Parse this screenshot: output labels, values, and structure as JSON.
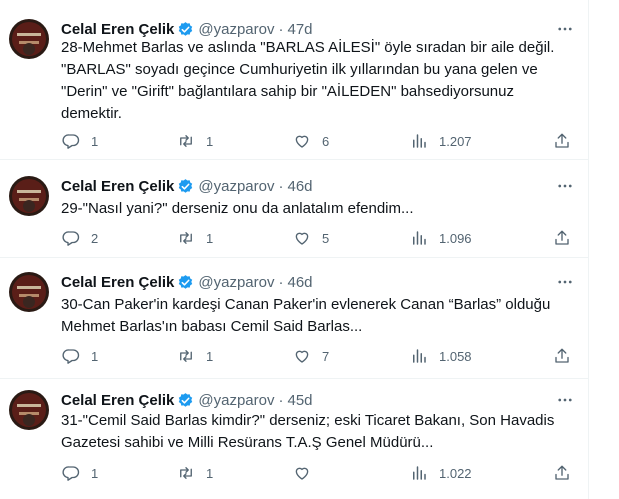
{
  "colors": {
    "text": "#0f1419",
    "secondary": "#536471",
    "verified": "#1d9bf0",
    "divider": "#eff3f4"
  },
  "tweets": [
    {
      "author": "Celal Eren Çelik",
      "handle": "@yazparov",
      "separator": "·",
      "time": "47d",
      "text": "28-Mehmet Barlas ve aslında \"BARLAS AİLESİ\" öyle sıradan bir aile değil.\n\"BARLAS\" soyadı geçince Cumhuriyetin ilk yıllarından bu yana gelen ve\n\"Derin\" ve \"Girift\" bağlantılara sahip bir \"AİLEDEN\" bahsediyorsunuz\ndemektir.",
      "replies": "1",
      "retweets": "1",
      "likes": "6",
      "views": "1.207"
    },
    {
      "author": "Celal Eren Çelik",
      "handle": "@yazparov",
      "separator": "·",
      "time": "46d",
      "text": "29-\"Nasıl yani?\" derseniz onu da anlatalım efendim...",
      "replies": "2",
      "retweets": "1",
      "likes": "5",
      "views": "1.096"
    },
    {
      "author": "Celal Eren Çelik",
      "handle": "@yazparov",
      "separator": "·",
      "time": "46d",
      "text": "30-Can Paker'in kardeşi Canan Paker'in evlenerek Canan “Barlas” olduğu\nMehmet Barlas'ın babası Cemil Said Barlas...",
      "replies": "1",
      "retweets": "1",
      "likes": "7",
      "views": "1.058"
    },
    {
      "author": "Celal Eren Çelik",
      "handle": "@yazparov",
      "separator": "·",
      "time": "45d",
      "text": "31-\"Cemil Said Barlas kimdir?\" derseniz; eski Ticaret Bakanı, Son Havadis\nGazetesi sahibi ve Milli Resürans T.A.Ş Genel Müdürü...",
      "replies": "1",
      "retweets": "1",
      "likes": "",
      "views": "1.022"
    }
  ],
  "icons": [
    "verified-badge-icon",
    "more-icon",
    "reply-icon",
    "retweet-icon",
    "like-icon",
    "views-icon",
    "share-icon"
  ]
}
